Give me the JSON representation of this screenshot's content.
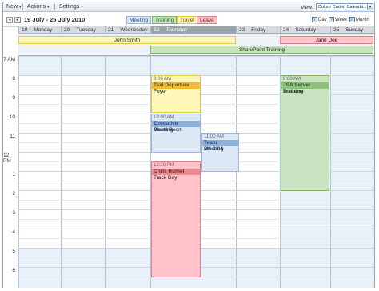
{
  "toolbar": {
    "new_label": "New",
    "actions_label": "Actions",
    "settings_label": "Settings",
    "caret": "▾"
  },
  "nav": {
    "prev_icon": "◂",
    "next_icon": "▸",
    "date_range": "19 July - 25 July 2010",
    "legend": [
      {
        "label": "Meeting",
        "bg": "#dde8f6",
        "border": "#9fb6d6",
        "color": "#2b4e7e"
      },
      {
        "label": "Training",
        "bg": "#c9e3c1",
        "border": "#7fb36d",
        "color": "#2f5e1f"
      },
      {
        "label": "Travel",
        "bg": "#fff6b8",
        "border": "#e1c94b",
        "color": "#6a5500"
      },
      {
        "label": "Leave",
        "bg": "#ffc3c9",
        "border": "#e18089",
        "color": "#7a1f28"
      }
    ],
    "view_label": "View:",
    "view_value": "Colour Coded Calenda...",
    "day_btn": "Day",
    "week_btn": "Week",
    "month_btn": "Month",
    "day_icon": "1",
    "week_icon": "7",
    "month_icon": "31"
  },
  "days": [
    {
      "num": "19",
      "name": "Monday"
    },
    {
      "num": "20",
      "name": "Tuesday"
    },
    {
      "num": "21",
      "name": "Wednesday"
    },
    {
      "num": "22",
      "name": "Thursday"
    },
    {
      "num": "23",
      "name": "Friday"
    },
    {
      "num": "24",
      "name": "Saturday"
    },
    {
      "num": "25",
      "name": "Sunday"
    }
  ],
  "all_day_events": [
    {
      "title": "John Smith",
      "category": "Travel"
    },
    {
      "title": "Jane Doe",
      "category": "Leave"
    },
    {
      "title": "SharePoint Training",
      "category": "Training"
    }
  ],
  "hours": [
    "7 AM",
    "8",
    "9",
    "10",
    "11",
    "12 PM",
    "1",
    "2",
    "3",
    "4",
    "5",
    "6"
  ],
  "events": [
    {
      "time": "8:00 AM",
      "title": "Taxi Departure",
      "location": "Foyer",
      "category": "Travel"
    },
    {
      "time": "10:00 AM",
      "title": "Executive Meeting",
      "location": "Board Room",
      "category": "Meeting"
    },
    {
      "time": "11:00 AM",
      "title": "Team Meeting",
      "location": "SG 2.04",
      "category": "Meeting"
    },
    {
      "time": "12:30 PM",
      "title": "Chris Rumel",
      "location": "Track Day",
      "category": "Leave"
    },
    {
      "time": "8:00 AM",
      "title": "JSA Server Training",
      "location": "Brisbane",
      "category": "Training"
    }
  ]
}
